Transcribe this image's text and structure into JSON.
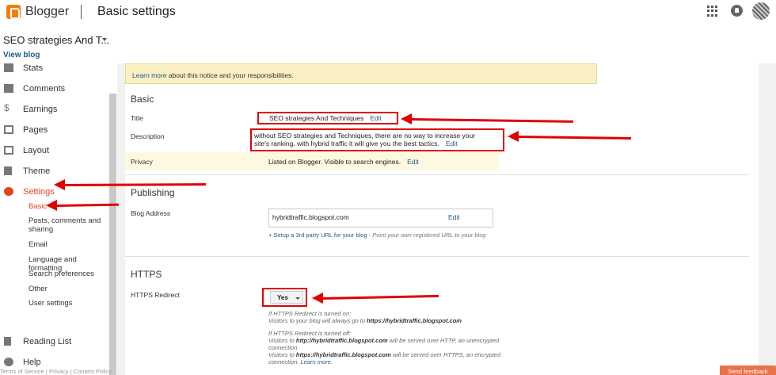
{
  "app": {
    "brand": "Blogger",
    "page_title": "Basic settings"
  },
  "blog": {
    "name": "SEO strategies And T...",
    "view_blog": "View blog"
  },
  "sidebar": {
    "items": [
      {
        "label": "Stats",
        "icon": "stats-icon"
      },
      {
        "label": "Comments",
        "icon": "comment-icon"
      },
      {
        "label": "Earnings",
        "icon": "dollar-icon"
      },
      {
        "label": "Pages",
        "icon": "pages-icon"
      },
      {
        "label": "Layout",
        "icon": "layout-icon"
      },
      {
        "label": "Theme",
        "icon": "theme-icon"
      },
      {
        "label": "Settings",
        "icon": "gear-icon",
        "active": true
      }
    ],
    "settings_subitems": [
      {
        "label": "Basic",
        "active": true
      },
      {
        "label": "Posts, comments and sharing"
      },
      {
        "label": "Email"
      },
      {
        "label": "Language and formatting"
      },
      {
        "label": "Search preferences"
      },
      {
        "label": "Other"
      },
      {
        "label": "User settings"
      }
    ],
    "bottom_items": [
      {
        "label": "Reading List",
        "icon": "bookmark-icon"
      },
      {
        "label": "Help",
        "icon": "help-icon"
      }
    ],
    "footer": "Terms of Service  |  Privacy  |  Content Policy"
  },
  "notice": {
    "link": "Learn more",
    "text": " about this notice and your responsibilities."
  },
  "basic": {
    "heading": "Basic",
    "title_label": "Title",
    "title_value": "SEO strategies And Techniques",
    "description_label": "Description",
    "description_value": "without SEO strategies and Techniques, there are no way to increase your site's ranking, with hybrid traffic it will give you the best tactics.",
    "privacy_label": "Privacy",
    "privacy_value": "Listed on Blogger. Visible to search engines.",
    "edit": "Edit"
  },
  "publishing": {
    "heading": "Publishing",
    "address_label": "Blog Address",
    "address_value": "hybridtraffic.blogspot.com",
    "edit": "Edit",
    "setup_link": "+ Setup a 3rd party URL for your blog",
    "setup_hint": " - Point your own registered URL to your blog"
  },
  "https": {
    "heading": "HTTPS",
    "redirect_label": "HTTPS Redirect",
    "redirect_value": "Yes",
    "on_title": "If HTTPS Redirect is turned on:",
    "on_text_pre": "Visitors to your blog will always go to ",
    "on_url": "https://hybridtraffic.blogspot.com",
    "off_title": "If HTTPS Redirect is turned off:",
    "off_line1_pre": "Visitors to ",
    "off_url_http": "http://hybridtraffic.blogspot.com",
    "off_line1_post": " will be served over HTTP, an unencrypted connection.",
    "off_line2_pre": "Visitors to ",
    "off_url_https": "https://hybridtraffic.blogspot.com",
    "off_line2_post": " will be served over HTTPS, an encrypted connection. ",
    "learn_more": "Learn more."
  },
  "feedback": "Send feedback",
  "colors": {
    "accent": "#e8401f",
    "annotation_red": "#e00000",
    "link": "#1a5a8a"
  }
}
